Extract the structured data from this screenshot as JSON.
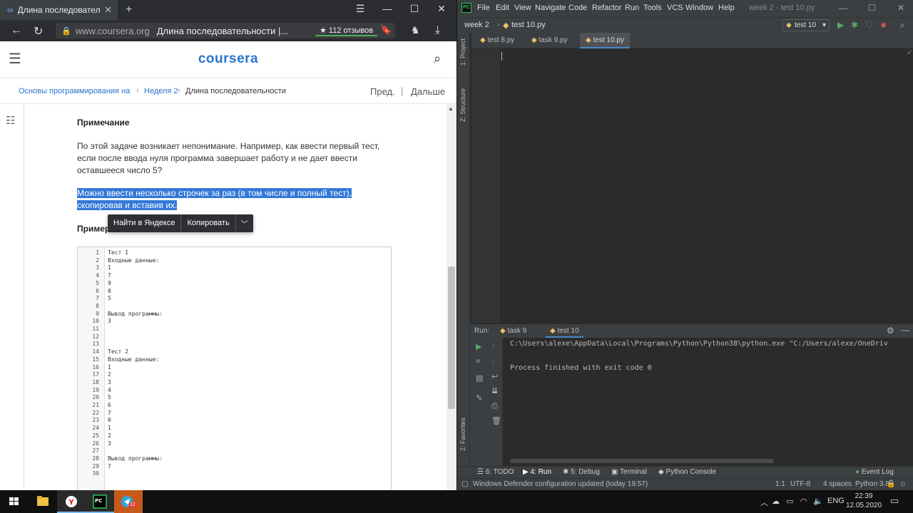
{
  "browser": {
    "tab_title": "Длина последовательн",
    "url_domain": "www.coursera.org",
    "page_title": "Длина последовательности |...",
    "reviews": "112 отзывов",
    "site": {
      "logo": "coursera",
      "breadcrumb": {
        "course": "Основы программирования на Pyth",
        "week": "Неделя 2",
        "current": "Длина последовательности"
      },
      "prev": "Пред.",
      "next": "Дальше"
    },
    "content": {
      "note_heading": "Примечание",
      "note_text": "По этой задаче возникает непонимание. Например, как ввести первый тест, если после ввода нуля программа завершает работу и не дает ввести оставшееся число 5?",
      "highlight_line1": "Можно ввести несколько строчек за раз (в том числе и полный тест),",
      "highlight_line2": "скопировав и вставив их.",
      "example_heading": "Пример",
      "context_menu": {
        "find": "Найти в Яндексе",
        "copy": "Копировать"
      },
      "code_lines": [
        "Тест 1",
        "Входные данные:",
        "1",
        "7",
        "9",
        "0",
        "5",
        "",
        "Вывод программы:",
        "3",
        "",
        "",
        "",
        "Тест 2",
        "Входные данные:",
        "1",
        "2",
        "3",
        "4",
        "5",
        "6",
        "7",
        "0",
        "1",
        "2",
        "3",
        "",
        "Вывод программы:",
        "7",
        ""
      ]
    }
  },
  "ide": {
    "logo": "PC",
    "menu": [
      "File",
      "Edit",
      "View",
      "Navigate",
      "Code",
      "Refactor",
      "Run",
      "Tools",
      "VCS",
      "Window",
      "Help"
    ],
    "window_title": "week 2 - test 10.py",
    "nav_folder": "week 2",
    "nav_file": "test 10.py",
    "run_config": "test 10",
    "tabs": [
      "test 8.py",
      "task 9.py",
      "test 10.py"
    ],
    "side_tabs": {
      "project": "1: Project",
      "structure": "Z: Structure",
      "favorites": "2: Favorites"
    },
    "run_label": "Run:",
    "run_tabs": [
      "task 9",
      "test 10"
    ],
    "console_lines": [
      "C:\\Users\\alexe\\AppData\\Local\\Programs\\Python\\Python38\\python.exe \"C:/Users/alexe/OneDriv",
      "",
      "Process finished with exit code 0"
    ],
    "bottom_tools": [
      "6: TODO",
      "4: Run",
      "5: Debug",
      "Terminal",
      "Python Console"
    ],
    "event_log": "Event Log",
    "status_message": "Windows Defender configuration updated (today 19:57)",
    "status_position": "1:1",
    "status_encoding": "UTF-8",
    "status_indent": "4 spaces",
    "status_interpreter": "Python 3.8"
  },
  "taskbar": {
    "language": "ENG",
    "time": "22:39",
    "date": "12.05.2020",
    "telegram_badge": "12"
  }
}
